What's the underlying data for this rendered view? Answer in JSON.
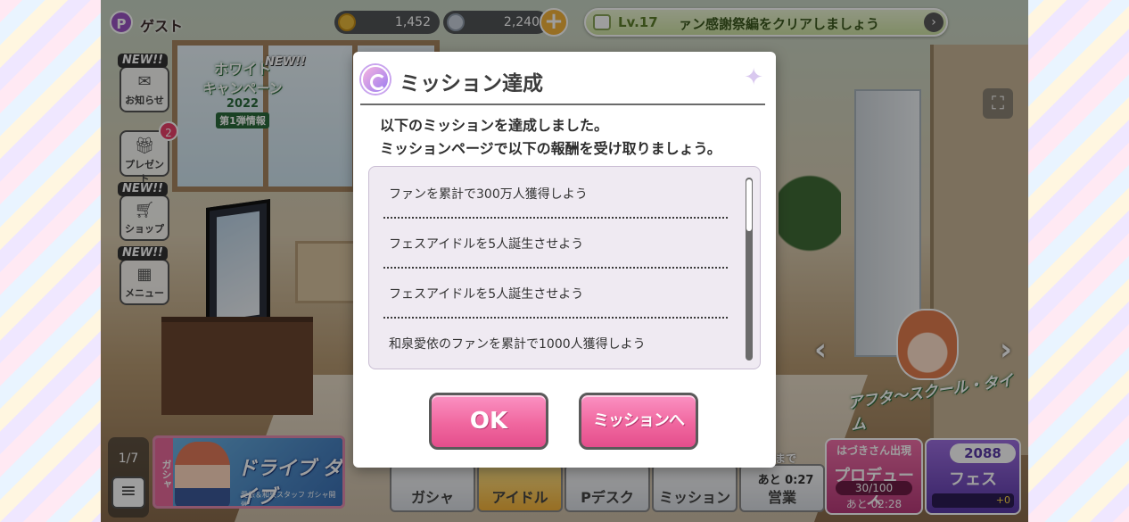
{
  "header": {
    "user_badge": "P",
    "username": "ゲスト",
    "coins": "1,452",
    "gems": "2,240",
    "plus": "+",
    "quest": {
      "level": "Lv.17",
      "text": "ァン感謝祭編をクリアしましょう",
      "arrow": "›"
    }
  },
  "side_menu": {
    "new_tag": "NEW!!",
    "notice_label": "お知らせ",
    "present_label": "プレゼント",
    "present_count": "2",
    "shop_label": "ショップ",
    "menu_label": "メニュー"
  },
  "campaign": {
    "line1": "ホワイト",
    "line2": "キャンペーン",
    "year": "2022",
    "sub": "第1弾情報",
    "new_tag": "NEW!!"
  },
  "bottom": {
    "page_indicator": "1/7",
    "gacha_tag": "ガシャ",
    "gacha_title": "ドライブ ダイブ",
    "gacha_sub": "愛依＆和泉スタッフ ガシャ開催",
    "tabs": [
      "ガシャ",
      "アイドル",
      "Pデスク",
      "ミッション",
      "営業"
    ],
    "eigyo_top": "まで",
    "eigyo_time": "あと 0:27",
    "produce": {
      "top": "はづきさん出現",
      "label": "プロデュース",
      "count": "30/100",
      "time": "あと 02:28"
    },
    "fes": {
      "value": "2088",
      "label": "フェス",
      "pt": "+0"
    }
  },
  "idol_banner": {
    "text": "アフタ〜スクール・タイム"
  },
  "dialog": {
    "title": "ミッション達成",
    "message_line1": "以下のミッションを達成しました。",
    "message_line2": "ミッションページで以下の報酬を受け取りましょう。",
    "missions": [
      "ファンを累計で300万人獲得しよう",
      "フェスアイドルを5人誕生させよう",
      "フェスアイドルを5人誕生させよう",
      "和泉愛依のファンを累計で1000人獲得しよう"
    ],
    "ok_label": "OK",
    "mission_label": "ミッションへ"
  },
  "colors": {
    "accent_pink": "#f0679f",
    "dialog_bg": "#ffffff",
    "list_bg": "#efeaf2"
  },
  "icons": [
    "p-badge-icon",
    "coin-icon",
    "gem-icon",
    "plus-icon",
    "quest-icon",
    "fullscreen-icon",
    "mail-icon",
    "gift-icon",
    "cart-icon",
    "grid-icon",
    "hamburger-icon",
    "mission-badge-icon",
    "sparkle-icon"
  ]
}
